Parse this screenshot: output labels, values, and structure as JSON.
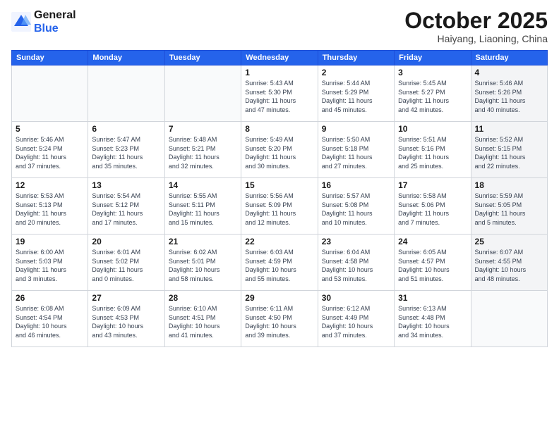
{
  "header": {
    "logo_general": "General",
    "logo_blue": "Blue",
    "month_title": "October 2025",
    "subtitle": "Haiyang, Liaoning, China"
  },
  "weekdays": [
    "Sunday",
    "Monday",
    "Tuesday",
    "Wednesday",
    "Thursday",
    "Friday",
    "Saturday"
  ],
  "weeks": [
    [
      {
        "day": "",
        "info": "",
        "empty": true
      },
      {
        "day": "",
        "info": "",
        "empty": true
      },
      {
        "day": "",
        "info": "",
        "empty": true
      },
      {
        "day": "1",
        "info": "Sunrise: 5:43 AM\nSunset: 5:30 PM\nDaylight: 11 hours\nand 47 minutes.",
        "shaded": false
      },
      {
        "day": "2",
        "info": "Sunrise: 5:44 AM\nSunset: 5:29 PM\nDaylight: 11 hours\nand 45 minutes.",
        "shaded": false
      },
      {
        "day": "3",
        "info": "Sunrise: 5:45 AM\nSunset: 5:27 PM\nDaylight: 11 hours\nand 42 minutes.",
        "shaded": false
      },
      {
        "day": "4",
        "info": "Sunrise: 5:46 AM\nSunset: 5:26 PM\nDaylight: 11 hours\nand 40 minutes.",
        "shaded": true
      }
    ],
    [
      {
        "day": "5",
        "info": "Sunrise: 5:46 AM\nSunset: 5:24 PM\nDaylight: 11 hours\nand 37 minutes.",
        "shaded": false
      },
      {
        "day": "6",
        "info": "Sunrise: 5:47 AM\nSunset: 5:23 PM\nDaylight: 11 hours\nand 35 minutes.",
        "shaded": false
      },
      {
        "day": "7",
        "info": "Sunrise: 5:48 AM\nSunset: 5:21 PM\nDaylight: 11 hours\nand 32 minutes.",
        "shaded": false
      },
      {
        "day": "8",
        "info": "Sunrise: 5:49 AM\nSunset: 5:20 PM\nDaylight: 11 hours\nand 30 minutes.",
        "shaded": false
      },
      {
        "day": "9",
        "info": "Sunrise: 5:50 AM\nSunset: 5:18 PM\nDaylight: 11 hours\nand 27 minutes.",
        "shaded": false
      },
      {
        "day": "10",
        "info": "Sunrise: 5:51 AM\nSunset: 5:16 PM\nDaylight: 11 hours\nand 25 minutes.",
        "shaded": false
      },
      {
        "day": "11",
        "info": "Sunrise: 5:52 AM\nSunset: 5:15 PM\nDaylight: 11 hours\nand 22 minutes.",
        "shaded": true
      }
    ],
    [
      {
        "day": "12",
        "info": "Sunrise: 5:53 AM\nSunset: 5:13 PM\nDaylight: 11 hours\nand 20 minutes.",
        "shaded": false
      },
      {
        "day": "13",
        "info": "Sunrise: 5:54 AM\nSunset: 5:12 PM\nDaylight: 11 hours\nand 17 minutes.",
        "shaded": false
      },
      {
        "day": "14",
        "info": "Sunrise: 5:55 AM\nSunset: 5:11 PM\nDaylight: 11 hours\nand 15 minutes.",
        "shaded": false
      },
      {
        "day": "15",
        "info": "Sunrise: 5:56 AM\nSunset: 5:09 PM\nDaylight: 11 hours\nand 12 minutes.",
        "shaded": false
      },
      {
        "day": "16",
        "info": "Sunrise: 5:57 AM\nSunset: 5:08 PM\nDaylight: 11 hours\nand 10 minutes.",
        "shaded": false
      },
      {
        "day": "17",
        "info": "Sunrise: 5:58 AM\nSunset: 5:06 PM\nDaylight: 11 hours\nand 7 minutes.",
        "shaded": false
      },
      {
        "day": "18",
        "info": "Sunrise: 5:59 AM\nSunset: 5:05 PM\nDaylight: 11 hours\nand 5 minutes.",
        "shaded": true
      }
    ],
    [
      {
        "day": "19",
        "info": "Sunrise: 6:00 AM\nSunset: 5:03 PM\nDaylight: 11 hours\nand 3 minutes.",
        "shaded": false
      },
      {
        "day": "20",
        "info": "Sunrise: 6:01 AM\nSunset: 5:02 PM\nDaylight: 11 hours\nand 0 minutes.",
        "shaded": false
      },
      {
        "day": "21",
        "info": "Sunrise: 6:02 AM\nSunset: 5:01 PM\nDaylight: 10 hours\nand 58 minutes.",
        "shaded": false
      },
      {
        "day": "22",
        "info": "Sunrise: 6:03 AM\nSunset: 4:59 PM\nDaylight: 10 hours\nand 55 minutes.",
        "shaded": false
      },
      {
        "day": "23",
        "info": "Sunrise: 6:04 AM\nSunset: 4:58 PM\nDaylight: 10 hours\nand 53 minutes.",
        "shaded": false
      },
      {
        "day": "24",
        "info": "Sunrise: 6:05 AM\nSunset: 4:57 PM\nDaylight: 10 hours\nand 51 minutes.",
        "shaded": false
      },
      {
        "day": "25",
        "info": "Sunrise: 6:07 AM\nSunset: 4:55 PM\nDaylight: 10 hours\nand 48 minutes.",
        "shaded": true
      }
    ],
    [
      {
        "day": "26",
        "info": "Sunrise: 6:08 AM\nSunset: 4:54 PM\nDaylight: 10 hours\nand 46 minutes.",
        "shaded": false
      },
      {
        "day": "27",
        "info": "Sunrise: 6:09 AM\nSunset: 4:53 PM\nDaylight: 10 hours\nand 43 minutes.",
        "shaded": false
      },
      {
        "day": "28",
        "info": "Sunrise: 6:10 AM\nSunset: 4:51 PM\nDaylight: 10 hours\nand 41 minutes.",
        "shaded": false
      },
      {
        "day": "29",
        "info": "Sunrise: 6:11 AM\nSunset: 4:50 PM\nDaylight: 10 hours\nand 39 minutes.",
        "shaded": false
      },
      {
        "day": "30",
        "info": "Sunrise: 6:12 AM\nSunset: 4:49 PM\nDaylight: 10 hours\nand 37 minutes.",
        "shaded": false
      },
      {
        "day": "31",
        "info": "Sunrise: 6:13 AM\nSunset: 4:48 PM\nDaylight: 10 hours\nand 34 minutes.",
        "shaded": false
      },
      {
        "day": "",
        "info": "",
        "empty": true
      }
    ]
  ]
}
